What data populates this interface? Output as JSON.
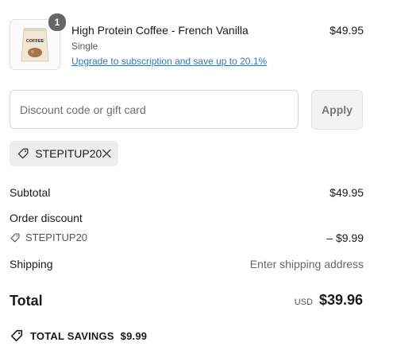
{
  "line_item": {
    "image_text": "COFFEE",
    "quantity": "1",
    "title": "High Protein Coffee - French Vanilla",
    "variant": "Single",
    "upgrade_link": "Upgrade to subscription and save up to 20.1%",
    "price": "$49.95"
  },
  "discount": {
    "placeholder": "Discount code or gift card",
    "apply_label": "Apply",
    "applied_code": "STEPITUP20"
  },
  "summary": {
    "subtotal_label": "Subtotal",
    "subtotal_value": "$49.95",
    "order_discount_label": "Order discount",
    "discount_code": "STEPITUP20",
    "discount_value": "– $9.99",
    "shipping_label": "Shipping",
    "shipping_value": "Enter shipping address",
    "total_label": "Total",
    "currency": "USD",
    "total_value": "$39.96",
    "savings_label": "TOTAL SAVINGS",
    "savings_value": "$9.99"
  },
  "icons": [
    "tag-icon",
    "close-icon"
  ],
  "colors": {
    "link": "#2a7bbd",
    "badge": "#666666",
    "chip_bg": "#ededed"
  }
}
